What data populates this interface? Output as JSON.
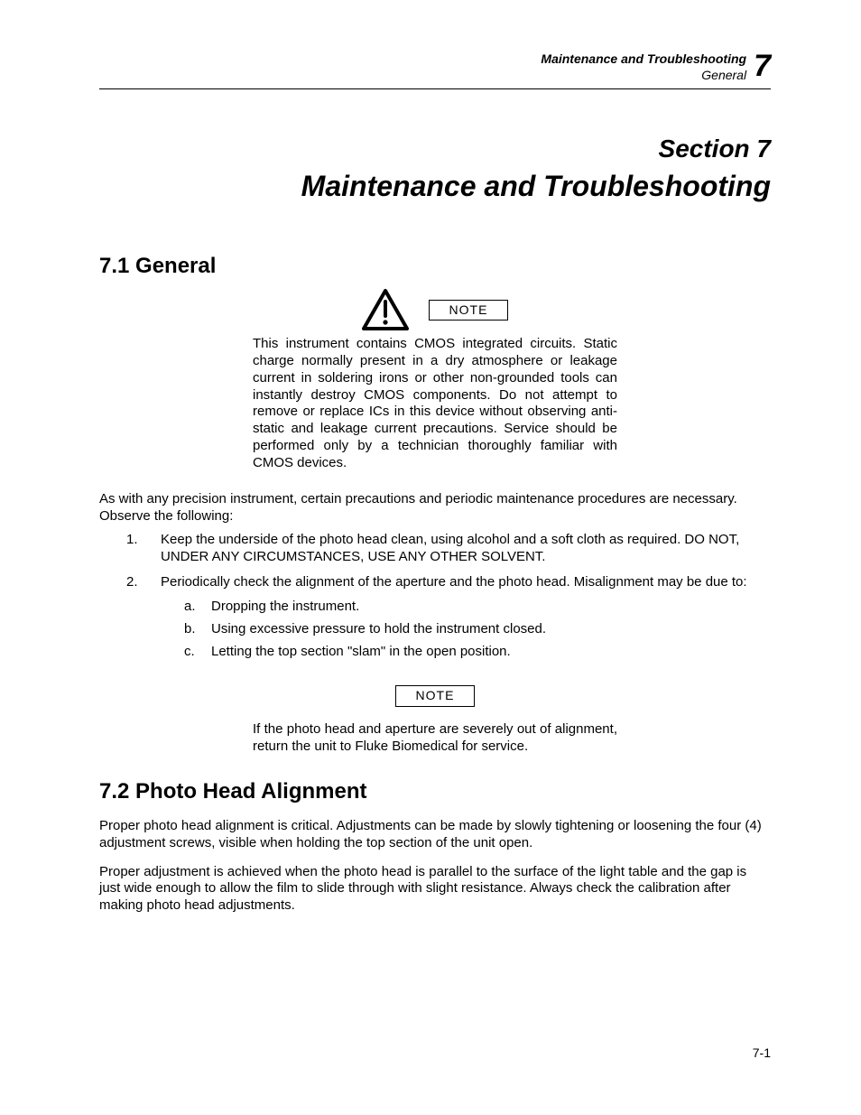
{
  "header": {
    "chapter": "Maintenance and Troubleshooting",
    "sub": "General",
    "num": "7"
  },
  "section_title": {
    "line1": "Section 7",
    "line2": "Maintenance and Troubleshooting"
  },
  "h71": "7.1 General",
  "note1_label": "NOTE",
  "note1_body": "This instrument contains CMOS integrated circuits. Static charge normally present in a dry atmosphere or leakage current in soldering irons or other non-grounded tools can instantly destroy CMOS components.  Do not attempt to remove or replace ICs in this device without observing anti-static and leakage current precautions.  Service should be performed only by a technician thoroughly familiar with CMOS devices.",
  "intro": "As with any precision instrument, certain precautions and periodic maintenance procedures are necessary.  Observe the following:",
  "list": {
    "item1_num": "1.",
    "item1": "Keep the underside of the photo head clean, using alcohol and a soft cloth as required.  DO NOT, UNDER ANY CIRCUMSTANCES, USE ANY OTHER SOLVENT.",
    "item2_num": "2.",
    "item2": "Periodically check the alignment of the aperture and the photo head.  Misalignment may be due to:",
    "sub_a_l": "a.",
    "sub_a": "Dropping the instrument.",
    "sub_b_l": "b.",
    "sub_b": "Using excessive pressure to hold the instrument closed.",
    "sub_c_l": "c.",
    "sub_c": "Letting the top section \"slam\" in the open position."
  },
  "note2_label": "NOTE",
  "note2_body": "If the photo head and aperture are severely out of alignment, return the unit to Fluke Biomedical for service.",
  "h72": "7.2 Photo Head Alignment",
  "para72a": "Proper photo head alignment is critical.  Adjustments can be made by slowly tightening or loosening the four (4) adjustment screws, visible when holding the top section of the unit open.",
  "para72b": "Proper adjustment is achieved when the photo head is parallel to the surface of the light table and the gap is just wide enough to allow the film to slide through with slight resistance.  Always check the calibration after making photo head adjustments.",
  "footer": "7-1"
}
